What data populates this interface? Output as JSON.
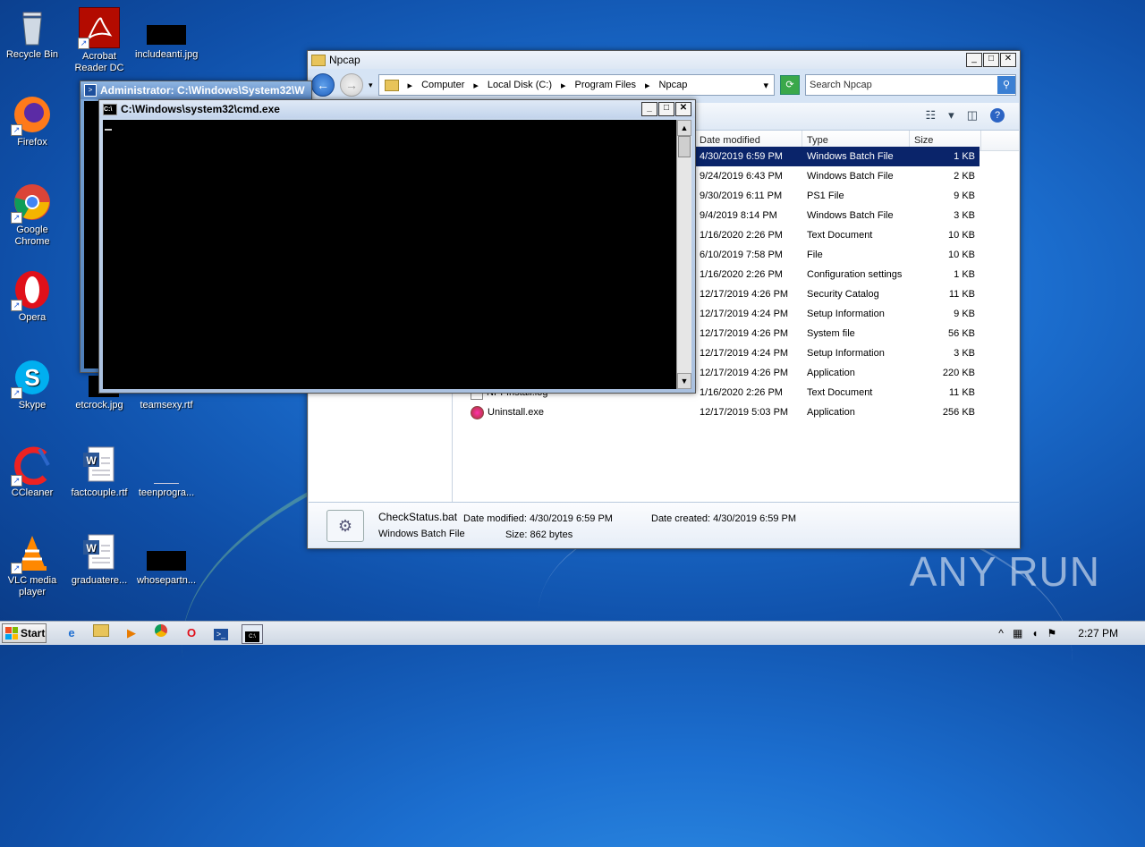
{
  "desktop": {
    "icons": [
      {
        "label": "Recycle Bin",
        "icon": "recycle-bin-icon"
      },
      {
        "label": "Acrobat Reader DC",
        "icon": "acrobat-icon"
      },
      {
        "label": "includeanti.jpg",
        "icon": "image-file-icon"
      },
      {
        "label": "Firefox",
        "icon": "firefox-icon"
      },
      {
        "label": "Google Chrome",
        "icon": "chrome-icon"
      },
      {
        "label": "Opera",
        "icon": "opera-icon"
      },
      {
        "label": "Skype",
        "icon": "skype-icon"
      },
      {
        "label": "etcrock.jpg",
        "icon": "image-file-icon"
      },
      {
        "label": "teamsexy.rtf",
        "icon": "rtf-file-icon"
      },
      {
        "label": "CCleaner",
        "icon": "ccleaner-icon"
      },
      {
        "label": "factcouple.rtf",
        "icon": "word-doc-icon"
      },
      {
        "label": "teenprogra...",
        "icon": "file-icon"
      },
      {
        "label": "VLC media player",
        "icon": "vlc-icon"
      },
      {
        "label": "graduatere...",
        "icon": "word-doc-icon"
      },
      {
        "label": "whosepartn...",
        "icon": "image-file-icon"
      }
    ]
  },
  "explorer": {
    "title": "Npcap",
    "breadcrumb": [
      "Computer",
      "Local Disk (C:)",
      "Program Files",
      "Npcap"
    ],
    "search_placeholder": "Search Npcap",
    "columns": {
      "date": "Date modified",
      "type": "Type",
      "size": "Size"
    },
    "files": [
      {
        "name": "",
        "date": "4/30/2019 6:59 PM",
        "type": "Windows Batch File",
        "size": "1 KB",
        "selected": true
      },
      {
        "name": "",
        "date": "9/24/2019 6:43 PM",
        "type": "Windows Batch File",
        "size": "2 KB"
      },
      {
        "name": "",
        "date": "9/30/2019 6:11 PM",
        "type": "PS1 File",
        "size": "9 KB"
      },
      {
        "name": "",
        "date": "9/4/2019 8:14 PM",
        "type": "Windows Batch File",
        "size": "3 KB"
      },
      {
        "name": "",
        "date": "1/16/2020 2:26 PM",
        "type": "Text Document",
        "size": "10 KB"
      },
      {
        "name": "",
        "date": "6/10/2019 7:58 PM",
        "type": "File",
        "size": "10 KB"
      },
      {
        "name": "",
        "date": "1/16/2020 2:26 PM",
        "type": "Configuration settings",
        "size": "1 KB"
      },
      {
        "name": "",
        "date": "12/17/2019 4:26 PM",
        "type": "Security Catalog",
        "size": "11 KB"
      },
      {
        "name": "",
        "date": "12/17/2019 4:24 PM",
        "type": "Setup Information",
        "size": "9 KB"
      },
      {
        "name": "",
        "date": "12/17/2019 4:26 PM",
        "type": "System file",
        "size": "56 KB"
      },
      {
        "name": "",
        "date": "12/17/2019 4:24 PM",
        "type": "Setup Information",
        "size": "3 KB"
      },
      {
        "name": "",
        "date": "12/17/2019 4:26 PM",
        "type": "Application",
        "size": "220 KB"
      },
      {
        "name": "NPFInstall.log",
        "date": "1/16/2020 2:26 PM",
        "type": "Text Document",
        "size": "11 KB"
      },
      {
        "name": "Uninstall.exe",
        "date": "12/17/2019 5:03 PM",
        "type": "Application",
        "size": "256 KB"
      }
    ],
    "details": {
      "name": "CheckStatus.bat",
      "type": "Windows Batch File",
      "modified": "Date modified: 4/30/2019 6:59 PM",
      "created": "Date created: 4/30/2019 6:59 PM",
      "size": "Size: 862 bytes"
    }
  },
  "admin_cmd": {
    "title": "Administrator: C:\\Windows\\System32\\W"
  },
  "cmd": {
    "title": "C:\\Windows\\system32\\cmd.exe",
    "cursor": "_"
  },
  "taskbar": {
    "start": "Start",
    "clock": "2:27 PM"
  },
  "watermark": "ANY RUN"
}
